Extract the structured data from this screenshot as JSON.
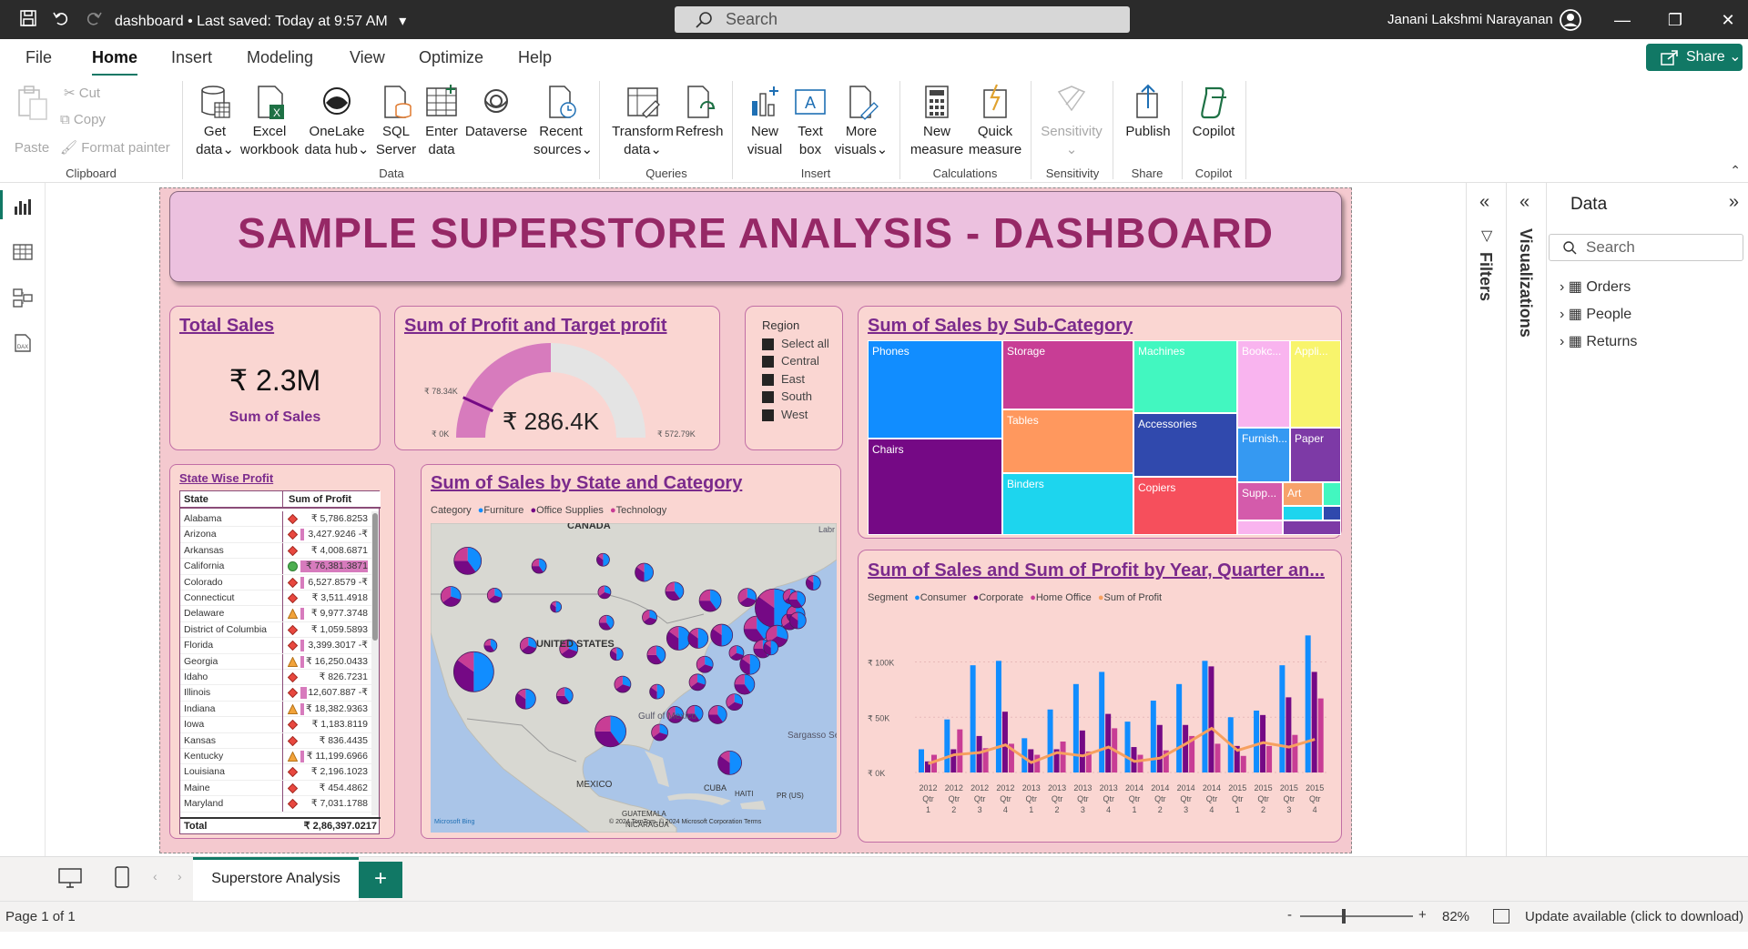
{
  "window": {
    "doc_title": "dashboard",
    "saved_status": "Last saved: Today at 9:57 AM",
    "search_placeholder": "Search",
    "user_name": "Janani Lakshmi Narayanan"
  },
  "menu": {
    "tabs": [
      "File",
      "Home",
      "Insert",
      "Modeling",
      "View",
      "Optimize",
      "Help"
    ],
    "active": "Home",
    "share_label": "Share"
  },
  "ribbon": {
    "clipboard": {
      "paste": "Paste",
      "cut": "Cut",
      "copy": "Copy",
      "format_painter": "Format painter",
      "group": "Clipboard"
    },
    "data": {
      "get_data": [
        "Get",
        "data"
      ],
      "excel": [
        "Excel",
        "workbook"
      ],
      "onelake": [
        "OneLake",
        "data hub"
      ],
      "sql": [
        "SQL",
        "Server"
      ],
      "enter": [
        "Enter",
        "data"
      ],
      "dataverse": [
        "Dataverse"
      ],
      "recent": [
        "Recent",
        "sources"
      ],
      "group": "Data"
    },
    "queries": {
      "transform": [
        "Transform",
        "data"
      ],
      "refresh": [
        "Refresh"
      ],
      "group": "Queries"
    },
    "insert": {
      "new_visual": [
        "New",
        "visual"
      ],
      "text_box": [
        "Text",
        "box"
      ],
      "more_visuals": [
        "More",
        "visuals"
      ],
      "group": "Insert"
    },
    "calculations": {
      "new_measure": [
        "New",
        "measure"
      ],
      "quick_measure": [
        "Quick",
        "measure"
      ],
      "group": "Calculations"
    },
    "sensitivity": {
      "label": "Sensitivity",
      "group": "Sensitivity"
    },
    "share": {
      "publish": "Publish",
      "group": "Share"
    },
    "copilot": {
      "label": "Copilot",
      "group": "Copilot"
    }
  },
  "dashboard": {
    "title": "SAMPLE SUPERSTORE ANALYSIS - DASHBOARD",
    "total_sales": {
      "title": "Total Sales",
      "value": "₹ 2.3M",
      "label": "Sum of Sales"
    },
    "gauge": {
      "title": "Sum of Profit and Target  profit",
      "value": "₹ 286.4K",
      "min": "₹ 0K",
      "max": "₹ 572.79K",
      "target": "₹ 78.34K",
      "value_fraction": 0.5,
      "target_fraction": 0.137
    },
    "region_slicer": {
      "title": "Region",
      "items": [
        "Select all",
        "Central",
        "East",
        "South",
        "West"
      ]
    },
    "state_table": {
      "title": "State Wise Profit",
      "headers": [
        "State",
        "Sum of Profit"
      ],
      "rows": [
        {
          "state": "Alabama",
          "profit": "₹ 5,786.8253",
          "marker": "diamond",
          "bar": 0
        },
        {
          "state": "Arizona",
          "profit": "3,427.9246 -₹",
          "marker": "diamond",
          "bar": 0.05
        },
        {
          "state": "Arkansas",
          "profit": "₹ 4,008.6871",
          "marker": "diamond",
          "bar": 0
        },
        {
          "state": "California",
          "profit": "₹ 76,381.3871",
          "marker": "circle",
          "bar": 1
        },
        {
          "state": "Colorado",
          "profit": "6,527.8579 -₹",
          "marker": "diamond",
          "bar": 0.05
        },
        {
          "state": "Connecticut",
          "profit": "₹ 3,511.4918",
          "marker": "diamond",
          "bar": 0
        },
        {
          "state": "Delaware",
          "profit": "₹ 9,977.3748",
          "marker": "triangle",
          "bar": 0.06
        },
        {
          "state": "District of Columbia",
          "profit": "₹ 1,059.5893",
          "marker": "diamond",
          "bar": 0
        },
        {
          "state": "Florida",
          "profit": "3,399.3017 -₹",
          "marker": "diamond",
          "bar": 0.05
        },
        {
          "state": "Georgia",
          "profit": "₹ 16,250.0433",
          "marker": "triangle",
          "bar": 0.06
        },
        {
          "state": "Idaho",
          "profit": "₹ 826.7231",
          "marker": "diamond",
          "bar": 0
        },
        {
          "state": "Illinois",
          "profit": "12,607.887 -₹",
          "marker": "diamond",
          "bar": 0.1
        },
        {
          "state": "Indiana",
          "profit": "₹ 18,382.9363",
          "marker": "triangle",
          "bar": 0.06
        },
        {
          "state": "Iowa",
          "profit": "₹ 1,183.8119",
          "marker": "diamond",
          "bar": 0
        },
        {
          "state": "Kansas",
          "profit": "₹ 836.4435",
          "marker": "diamond",
          "bar": 0
        },
        {
          "state": "Kentucky",
          "profit": "₹ 11,199.6966",
          "marker": "triangle",
          "bar": 0.06
        },
        {
          "state": "Louisiana",
          "profit": "₹ 2,196.1023",
          "marker": "diamond",
          "bar": 0
        },
        {
          "state": "Maine",
          "profit": "₹ 454.4862",
          "marker": "diamond",
          "bar": 0
        },
        {
          "state": "Maryland",
          "profit": "₹ 7,031.1788",
          "marker": "diamond",
          "bar": 0
        }
      ],
      "total_label": "Total",
      "total_value": "₹ 2,86,397.0217"
    },
    "map": {
      "title": "Sum of Sales by State and Category",
      "legend_title": "Category",
      "legend": [
        {
          "name": "Furniture",
          "color": "#118DFF"
        },
        {
          "name": "Office Supplies",
          "color": "#750985"
        },
        {
          "name": "Technology",
          "color": "#C83D95"
        }
      ],
      "labels": {
        "canada": "CANADA",
        "us": "UNITED STATES",
        "mexico": "MEXICO",
        "gulf": "Gulf of Mexico",
        "sargasso": "Sargasso Sea",
        "cuba": "CUBA",
        "haiti": "HAITI",
        "pr": "PR (US)",
        "guatemala": "GUATEMALA",
        "nicaragua": "NICARAGUA",
        "labr": "Labr"
      },
      "attribution": "© 2024 TomTom, © 2024 Microsoft Corporation  Terms",
      "logo": "Microsoft Bing"
    },
    "treemap": {
      "title": "Sum of Sales by Sub-Category",
      "tiles": [
        {
          "name": "Phones",
          "color": "#118DFF"
        },
        {
          "name": "Chairs",
          "color": "#750985"
        },
        {
          "name": "Storage",
          "color": "#C83D95"
        },
        {
          "name": "Tables",
          "color": "#FF985E"
        },
        {
          "name": "Binders",
          "color": "#1DD5EE"
        },
        {
          "name": "Machines",
          "color": "#42F7C0"
        },
        {
          "name": "Accessories",
          "color": "#3049AD"
        },
        {
          "name": "Copiers",
          "color": "#F64F5C"
        },
        {
          "name": "Bookc...",
          "color": "#F9B4EF"
        },
        {
          "name": "Appli...",
          "color": "#F8F46C"
        },
        {
          "name": "Furnish...",
          "color": "#3599F2"
        },
        {
          "name": "Paper",
          "color": "#7D3AA6"
        },
        {
          "name": "Supp...",
          "color": "#D45BAB"
        },
        {
          "name": "Art",
          "color": "#F7A26A"
        }
      ]
    },
    "combo": {
      "title": "Sum of Sales and Sum of Profit by Year, Quarter an...",
      "legend_title": "Segment",
      "legend": [
        {
          "name": "Consumer",
          "color": "#118DFF"
        },
        {
          "name": "Corporate",
          "color": "#750985"
        },
        {
          "name": "Home Office",
          "color": "#C83D95"
        },
        {
          "name": "Sum of Profit",
          "color": "#F6A05F"
        }
      ],
      "y_ticks": [
        "₹ 100K",
        "₹ 50K",
        "₹ 0K"
      ]
    },
    "filters_label": "Filters",
    "visualizations_label": "Visualizations"
  },
  "chart_data": {
    "type": "bar",
    "title": "Sum of Sales and Sum of Profit by Year, Quarter an...",
    "categories": [
      "2012 Qtr 1",
      "2012 Qtr 2",
      "2012 Qtr 3",
      "2012 Qtr 4",
      "2013 Qtr 1",
      "2013 Qtr 2",
      "2013 Qtr 3",
      "2013 Qtr 4",
      "2014 Qtr 1",
      "2014 Qtr 2",
      "2014 Qtr 3",
      "2014 Qtr 4",
      "2015 Qtr 1",
      "2015 Qtr 2",
      "2015 Qtr 3",
      "2015 Qtr 4"
    ],
    "ylim": [
      0,
      135000
    ],
    "series": [
      {
        "name": "Consumer",
        "type": "bar",
        "values": [
          21000,
          48000,
          97000,
          101000,
          31000,
          57000,
          80000,
          91000,
          46000,
          65000,
          80000,
          101000,
          50000,
          56000,
          97000,
          124000
        ]
      },
      {
        "name": "Corporate",
        "type": "bar",
        "values": [
          10000,
          21000,
          33000,
          55000,
          21000,
          21000,
          38000,
          53000,
          23000,
          43000,
          43000,
          96000,
          24000,
          52000,
          68000,
          91000
        ]
      },
      {
        "name": "Home Office",
        "type": "bar",
        "values": [
          16000,
          39000,
          22000,
          26000,
          16000,
          28000,
          19000,
          40000,
          16000,
          20000,
          33000,
          26000,
          15000,
          24000,
          34000,
          67000
        ]
      },
      {
        "name": "Sum of Profit",
        "type": "line",
        "values": [
          8000,
          16000,
          18000,
          25000,
          9000,
          18000,
          15000,
          23000,
          10000,
          13000,
          26000,
          40000,
          20000,
          27000,
          23000,
          30000
        ]
      }
    ]
  },
  "map_points": [
    {
      "lon": -123.0,
      "lat": 44.0,
      "size": 11
    },
    {
      "lon": -120.5,
      "lat": 47.4,
      "size": 15
    },
    {
      "lon": -119.6,
      "lat": 36.8,
      "size": 22
    },
    {
      "lon": -116.5,
      "lat": 44.1,
      "size": 8
    },
    {
      "lon": -117.1,
      "lat": 39.3,
      "size": 7
    },
    {
      "lon": -111.9,
      "lat": 34.2,
      "size": 11
    },
    {
      "lon": -111.5,
      "lat": 39.3,
      "size": 9
    },
    {
      "lon": -109.9,
      "lat": 46.9,
      "size": 8
    },
    {
      "lon": -107.4,
      "lat": 43.0,
      "size": 6
    },
    {
      "lon": -105.5,
      "lat": 39.0,
      "size": 10
    },
    {
      "lon": -106.1,
      "lat": 34.5,
      "size": 9
    },
    {
      "lon": -100.4,
      "lat": 47.5,
      "size": 7
    },
    {
      "lon": -100.2,
      "lat": 44.4,
      "size": 7
    },
    {
      "lon": -99.9,
      "lat": 41.5,
      "size": 8
    },
    {
      "lon": -98.4,
      "lat": 38.5,
      "size": 7
    },
    {
      "lon": -97.5,
      "lat": 35.6,
      "size": 9
    },
    {
      "lon": -99.3,
      "lat": 31.1,
      "size": 17
    },
    {
      "lon": -94.3,
      "lat": 46.3,
      "size": 10
    },
    {
      "lon": -93.5,
      "lat": 42.0,
      "size": 8
    },
    {
      "lon": -92.5,
      "lat": 38.4,
      "size": 10
    },
    {
      "lon": -92.4,
      "lat": 34.9,
      "size": 8
    },
    {
      "lon": -92.0,
      "lat": 31.0,
      "size": 9
    },
    {
      "lon": -89.8,
      "lat": 44.5,
      "size": 10
    },
    {
      "lon": -89.2,
      "lat": 40.0,
      "size": 13
    },
    {
      "lon": -89.7,
      "lat": 32.7,
      "size": 9
    },
    {
      "lon": -86.8,
      "lat": 32.8,
      "size": 9
    },
    {
      "lon": -86.3,
      "lat": 40.0,
      "size": 11
    },
    {
      "lon": -85.3,
      "lat": 37.5,
      "size": 9
    },
    {
      "lon": -84.5,
      "lat": 43.6,
      "size": 12
    },
    {
      "lon": -82.8,
      "lat": 40.3,
      "size": 12
    },
    {
      "lon": -86.4,
      "lat": 35.8,
      "size": 9
    },
    {
      "lon": -83.4,
      "lat": 32.7,
      "size": 10
    },
    {
      "lon": -81.6,
      "lat": 28.1,
      "size": 13
    },
    {
      "lon": -80.9,
      "lat": 33.9,
      "size": 9
    },
    {
      "lon": -79.4,
      "lat": 35.6,
      "size": 11
    },
    {
      "lon": -78.6,
      "lat": 37.5,
      "size": 11
    },
    {
      "lon": -80.6,
      "lat": 38.6,
      "size": 8
    },
    {
      "lon": -77.6,
      "lat": 40.9,
      "size": 14
    },
    {
      "lon": -75.0,
      "lat": 42.9,
      "size": 21
    },
    {
      "lon": -74.6,
      "lat": 40.2,
      "size": 12
    },
    {
      "lon": -76.7,
      "lat": 39.0,
      "size": 10
    },
    {
      "lon": -75.5,
      "lat": 39.1,
      "size": 8
    },
    {
      "lon": -72.7,
      "lat": 41.6,
      "size": 9
    },
    {
      "lon": -71.8,
      "lat": 42.3,
      "size": 10
    },
    {
      "lon": -71.5,
      "lat": 41.7,
      "size": 9
    },
    {
      "lon": -72.6,
      "lat": 44.0,
      "size": 8
    },
    {
      "lon": -71.6,
      "lat": 43.7,
      "size": 9
    },
    {
      "lon": -69.2,
      "lat": 45.3,
      "size": 8
    },
    {
      "lon": -79.0,
      "lat": 43.9,
      "size": 10
    }
  ]
}
